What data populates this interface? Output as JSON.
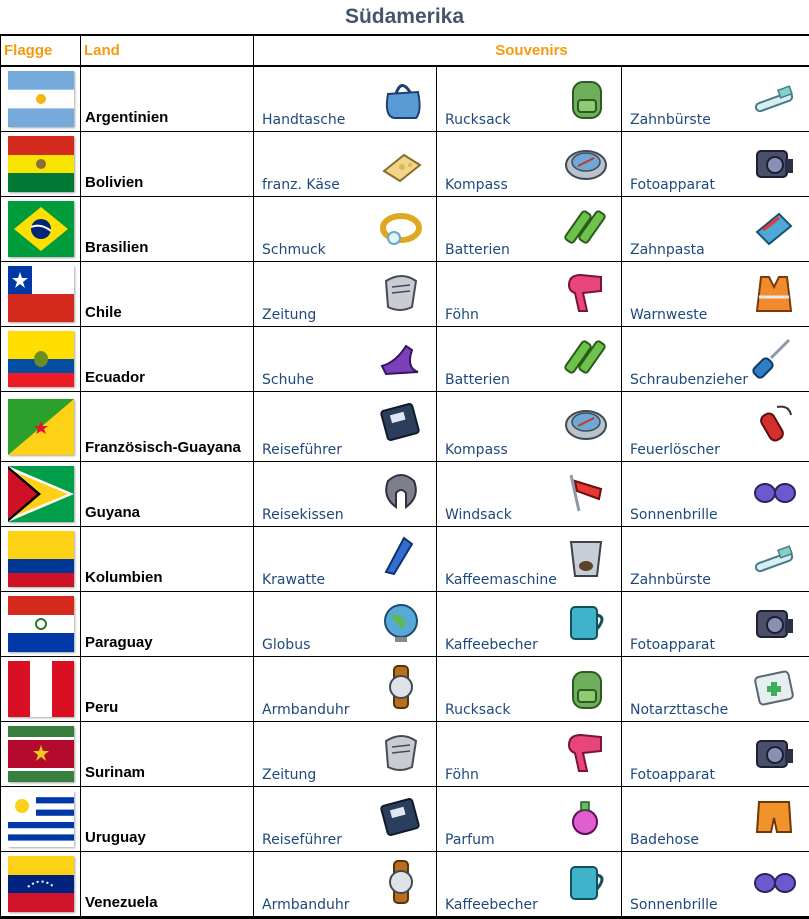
{
  "title": "Südamerika",
  "headers": {
    "flag": "Flagge",
    "country": "Land",
    "souvenirs": "Souvenirs"
  },
  "rows": [
    {
      "country": "Argentinien",
      "flag": "argentina-flag",
      "souvenirs": [
        {
          "name": "Handtasche",
          "icon": "handbag-icon"
        },
        {
          "name": "Rucksack",
          "icon": "backpack-icon"
        },
        {
          "name": "Zahnbürste",
          "icon": "toothbrush-icon"
        }
      ]
    },
    {
      "country": "Bolivien",
      "flag": "bolivia-flag",
      "souvenirs": [
        {
          "name": "franz. Käse",
          "icon": "cheese-icon"
        },
        {
          "name": "Kompass",
          "icon": "compass-icon"
        },
        {
          "name": "Fotoapparat",
          "icon": "camera-icon"
        }
      ]
    },
    {
      "country": "Brasilien",
      "flag": "brazil-flag",
      "souvenirs": [
        {
          "name": "Schmuck",
          "icon": "ring-icon"
        },
        {
          "name": "Batterien",
          "icon": "batteries-icon"
        },
        {
          "name": "Zahnpasta",
          "icon": "toothpaste-icon"
        }
      ]
    },
    {
      "country": "Chile",
      "flag": "chile-flag",
      "souvenirs": [
        {
          "name": "Zeitung",
          "icon": "newspaper-icon"
        },
        {
          "name": "Föhn",
          "icon": "hairdryer-icon"
        },
        {
          "name": "Warnweste",
          "icon": "safety-vest-icon"
        }
      ]
    },
    {
      "country": "Ecuador",
      "flag": "ecuador-flag",
      "souvenirs": [
        {
          "name": "Schuhe",
          "icon": "shoes-icon"
        },
        {
          "name": "Batterien",
          "icon": "batteries-icon"
        },
        {
          "name": "Schraubenzieher",
          "icon": "screwdriver-icon"
        }
      ]
    },
    {
      "country": "Französisch-Guayana",
      "flag": "french-guiana-flag",
      "souvenirs": [
        {
          "name": "Reiseführer",
          "icon": "guidebook-icon"
        },
        {
          "name": "Kompass",
          "icon": "compass-icon"
        },
        {
          "name": "Feuerlöscher",
          "icon": "fire-extinguisher-icon"
        }
      ]
    },
    {
      "country": "Guyana",
      "flag": "guyana-flag",
      "souvenirs": [
        {
          "name": "Reisekissen",
          "icon": "travel-pillow-icon"
        },
        {
          "name": "Windsack",
          "icon": "windsock-icon"
        },
        {
          "name": "Sonnenbrille",
          "icon": "sunglasses-icon"
        }
      ]
    },
    {
      "country": "Kolumbien",
      "flag": "colombia-flag",
      "souvenirs": [
        {
          "name": "Krawatte",
          "icon": "tie-icon"
        },
        {
          "name": "Kaffeemaschine",
          "icon": "coffee-machine-icon"
        },
        {
          "name": "Zahnbürste",
          "icon": "toothbrush-icon"
        }
      ]
    },
    {
      "country": "Paraguay",
      "flag": "paraguay-flag",
      "souvenirs": [
        {
          "name": "Globus",
          "icon": "globe-icon"
        },
        {
          "name": "Kaffeebecher",
          "icon": "coffee-mug-icon"
        },
        {
          "name": "Fotoapparat",
          "icon": "camera-icon"
        }
      ]
    },
    {
      "country": "Peru",
      "flag": "peru-flag",
      "souvenirs": [
        {
          "name": "Armbanduhr",
          "icon": "wristwatch-icon"
        },
        {
          "name": "Rucksack",
          "icon": "backpack-icon"
        },
        {
          "name": "Notarzttasche",
          "icon": "first-aid-bag-icon"
        }
      ]
    },
    {
      "country": "Surinam",
      "flag": "suriname-flag",
      "souvenirs": [
        {
          "name": "Zeitung",
          "icon": "newspaper-icon"
        },
        {
          "name": "Föhn",
          "icon": "hairdryer-icon"
        },
        {
          "name": "Fotoapparat",
          "icon": "camera-icon"
        }
      ]
    },
    {
      "country": "Uruguay",
      "flag": "uruguay-flag",
      "souvenirs": [
        {
          "name": "Reiseführer",
          "icon": "guidebook-icon"
        },
        {
          "name": "Parfum",
          "icon": "perfume-icon"
        },
        {
          "name": "Badehose",
          "icon": "swim-trunks-icon"
        }
      ]
    },
    {
      "country": "Venezuela",
      "flag": "venezuela-flag",
      "souvenirs": [
        {
          "name": "Armbanduhr",
          "icon": "wristwatch-icon"
        },
        {
          "name": "Kaffeebecher",
          "icon": "coffee-mug-icon"
        },
        {
          "name": "Sonnenbrille",
          "icon": "sunglasses-icon"
        }
      ]
    }
  ]
}
